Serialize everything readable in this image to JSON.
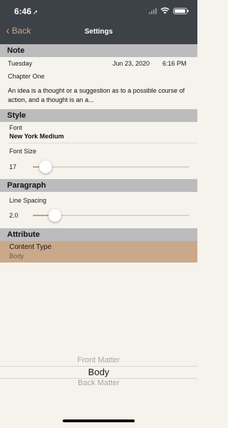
{
  "status": {
    "time": "6:46"
  },
  "nav": {
    "back_label": "Back",
    "title": "Settings"
  },
  "colors": {
    "accent": "#c4a182",
    "header_bg": "#3d4148",
    "section_bg": "#bcbcbe",
    "page_bg": "#f5f3ec"
  },
  "note": {
    "header": "Note",
    "day": "Tuesday",
    "date": "Jun 23, 2020",
    "time": "6:16 PM",
    "chapter": "Chapter One",
    "body": "An idea is a thought or a suggestion as to a possible course of action, and a thought is an a..."
  },
  "style": {
    "header": "Style",
    "font_label": "Font",
    "font_value": "New York Medium",
    "font_size_label": "Font Size",
    "font_size_value": "17",
    "font_size_fraction": 0.08
  },
  "paragraph": {
    "header": "Paragraph",
    "line_spacing_label": "Line Spacing",
    "line_spacing_value": "2.0",
    "line_spacing_fraction": 0.14
  },
  "attribute": {
    "header": "Attribute",
    "content_type_label": "Content Type",
    "content_type_value": "Body"
  },
  "picker": {
    "options": [
      "Front Matter",
      "Body",
      "Back Matter"
    ],
    "selected": "Body"
  }
}
